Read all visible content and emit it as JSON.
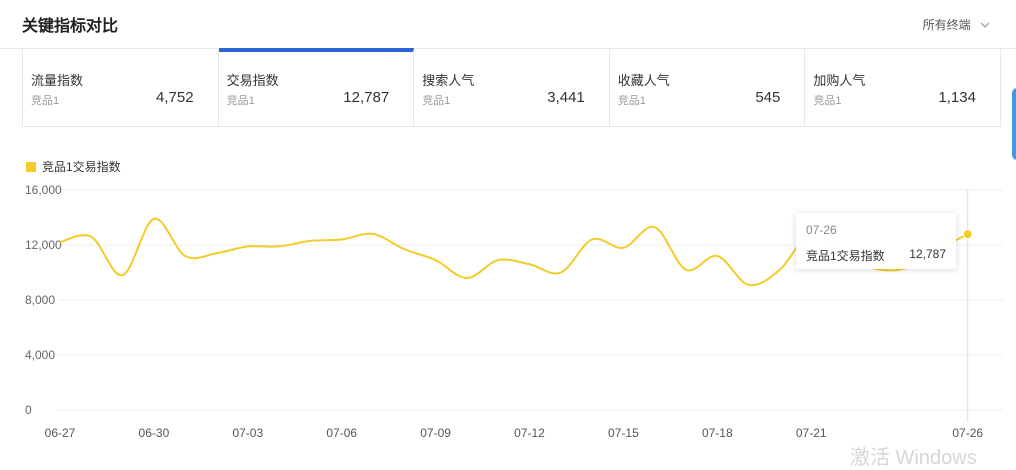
{
  "header": {
    "title": "关键指标对比",
    "terminal_label": "所有终端"
  },
  "cards": [
    {
      "name": "流量指数",
      "sub": "竞品1",
      "value": "4,752",
      "active": false
    },
    {
      "name": "交易指数",
      "sub": "竞品1",
      "value": "12,787",
      "active": true
    },
    {
      "name": "搜索人气",
      "sub": "竞品1",
      "value": "3,441",
      "active": false
    },
    {
      "name": "收藏人气",
      "sub": "竞品1",
      "value": "545",
      "active": false
    },
    {
      "name": "加购人气",
      "sub": "竞品1",
      "value": "1,134",
      "active": false
    }
  ],
  "colors": {
    "accent": "#2b64d8",
    "series": "#f2cc2a"
  },
  "watermark": "激活 Windows",
  "chart_data": {
    "type": "line",
    "ylim": [
      0,
      16000
    ],
    "y_ticks": [
      "16,000",
      "12,000",
      "8,000",
      "4,000",
      "0"
    ],
    "x_ticks": [
      "06-27",
      "06-30",
      "07-03",
      "07-06",
      "07-09",
      "07-12",
      "07-15",
      "07-18",
      "07-21",
      "07-26"
    ],
    "legend": "竞品1交易指数",
    "grid": true,
    "series": [
      {
        "name": "竞品1交易指数",
        "x": [
          "06-27",
          "06-28",
          "06-29",
          "06-30",
          "07-01",
          "07-02",
          "07-03",
          "07-04",
          "07-05",
          "07-06",
          "07-07",
          "07-08",
          "07-09",
          "07-10",
          "07-11",
          "07-12",
          "07-13",
          "07-14",
          "07-15",
          "07-16",
          "07-17",
          "07-18",
          "07-19",
          "07-20",
          "07-21",
          "07-22",
          "07-23",
          "07-24",
          "07-25",
          "07-26"
        ],
        "values": [
          12200,
          12600,
          9800,
          13900,
          11200,
          11400,
          11900,
          11900,
          12300,
          12400,
          12800,
          11700,
          10900,
          9600,
          10900,
          10600,
          10000,
          12400,
          11800,
          13300,
          10200,
          11200,
          9100,
          10200,
          12900,
          11400,
          10300,
          10300,
          11600,
          12787
        ]
      }
    ],
    "tooltip": {
      "date": "07-26",
      "label": "竞品1交易指数",
      "value": "12,787"
    }
  }
}
